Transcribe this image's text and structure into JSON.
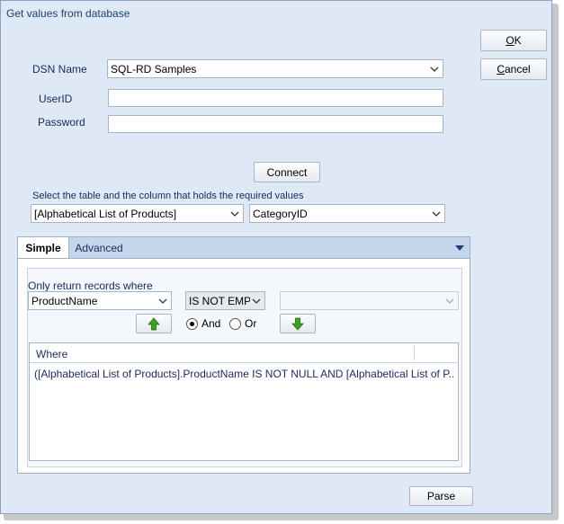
{
  "window": {
    "title": "Get values from database"
  },
  "buttons": {
    "ok": {
      "prefix": "",
      "accel": "O",
      "rest": "K"
    },
    "cancel": {
      "prefix": "",
      "accel": "C",
      "rest": "ancel"
    },
    "connect": "Connect",
    "parse": "Parse"
  },
  "connection": {
    "dsn_label": "DSN Name",
    "dsn_value": "SQL-RD Samples",
    "userid_label": "UserID",
    "userid_value": "",
    "password_label": "Password",
    "password_value": ""
  },
  "selection": {
    "instruction": "Select the table and the column that holds the required values",
    "table_value": "[Alphabetical List of Products]",
    "column_value": "CategoryID"
  },
  "tabs": [
    {
      "label": "Simple",
      "active": true
    },
    {
      "label": "Advanced",
      "active": false
    }
  ],
  "filter": {
    "label": "Only return records where",
    "field_value": "ProductName",
    "operator_value": "IS NOT EMPT'",
    "value_value": "",
    "logic_options": [
      {
        "label": "And",
        "selected": true
      },
      {
        "label": "Or",
        "selected": false
      }
    ]
  },
  "where_grid": {
    "column_header": "Where",
    "rows": [
      "([Alphabetical List of Products].ProductName IS NOT NULL AND [Alphabetical List of P..."
    ]
  },
  "icons": {
    "move_up": "arrow-up-icon",
    "move_down": "arrow-down-icon",
    "dropdown": "chevron-down-icon"
  },
  "colors": {
    "window_bg": "#dfe9f5",
    "title_text": "#1e3f73",
    "arrow_green": "#3aa51c"
  }
}
